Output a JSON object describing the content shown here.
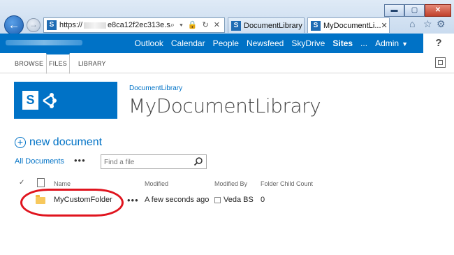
{
  "browser": {
    "url_start": "https://",
    "url_end": "e8ca12f2ec313e.s",
    "address_tools": "⌕ ▾ 🔒 ↻ ✕",
    "tabs": [
      {
        "label": "DocumentLibrary"
      },
      {
        "label": "MyDocumentLi..."
      }
    ],
    "tab_close": "✕",
    "window_controls": {
      "minimize": "▬",
      "maximize": "▢",
      "close": "✕"
    }
  },
  "suite_bar": {
    "nav": [
      "Outlook",
      "Calendar",
      "People",
      "Newsfeed",
      "SkyDrive",
      "Sites",
      "..."
    ],
    "user": "Admin",
    "help": "?"
  },
  "ribbon": {
    "tabs": [
      "BROWSE",
      "FILES",
      "LIBRARY"
    ]
  },
  "site": {
    "breadcrumb": "DocumentLibrary",
    "title": "MyDocumentLibrary",
    "logo_letter": "S"
  },
  "commands": {
    "new_document": "new document",
    "view": "All Documents",
    "more": "•••",
    "search_placeholder": "Find a file"
  },
  "list": {
    "columns": [
      "Name",
      "Modified",
      "Modified By",
      "Folder Child Count"
    ],
    "rows": [
      {
        "name": "MyCustomFolder",
        "modified": "A few seconds ago",
        "modified_by": "Veda BS",
        "child_count": "0"
      }
    ]
  },
  "colors": {
    "suite_blue": "#0072c6",
    "annotation_red": "#e0141e",
    "folder_yellow": "#f7c85c"
  }
}
